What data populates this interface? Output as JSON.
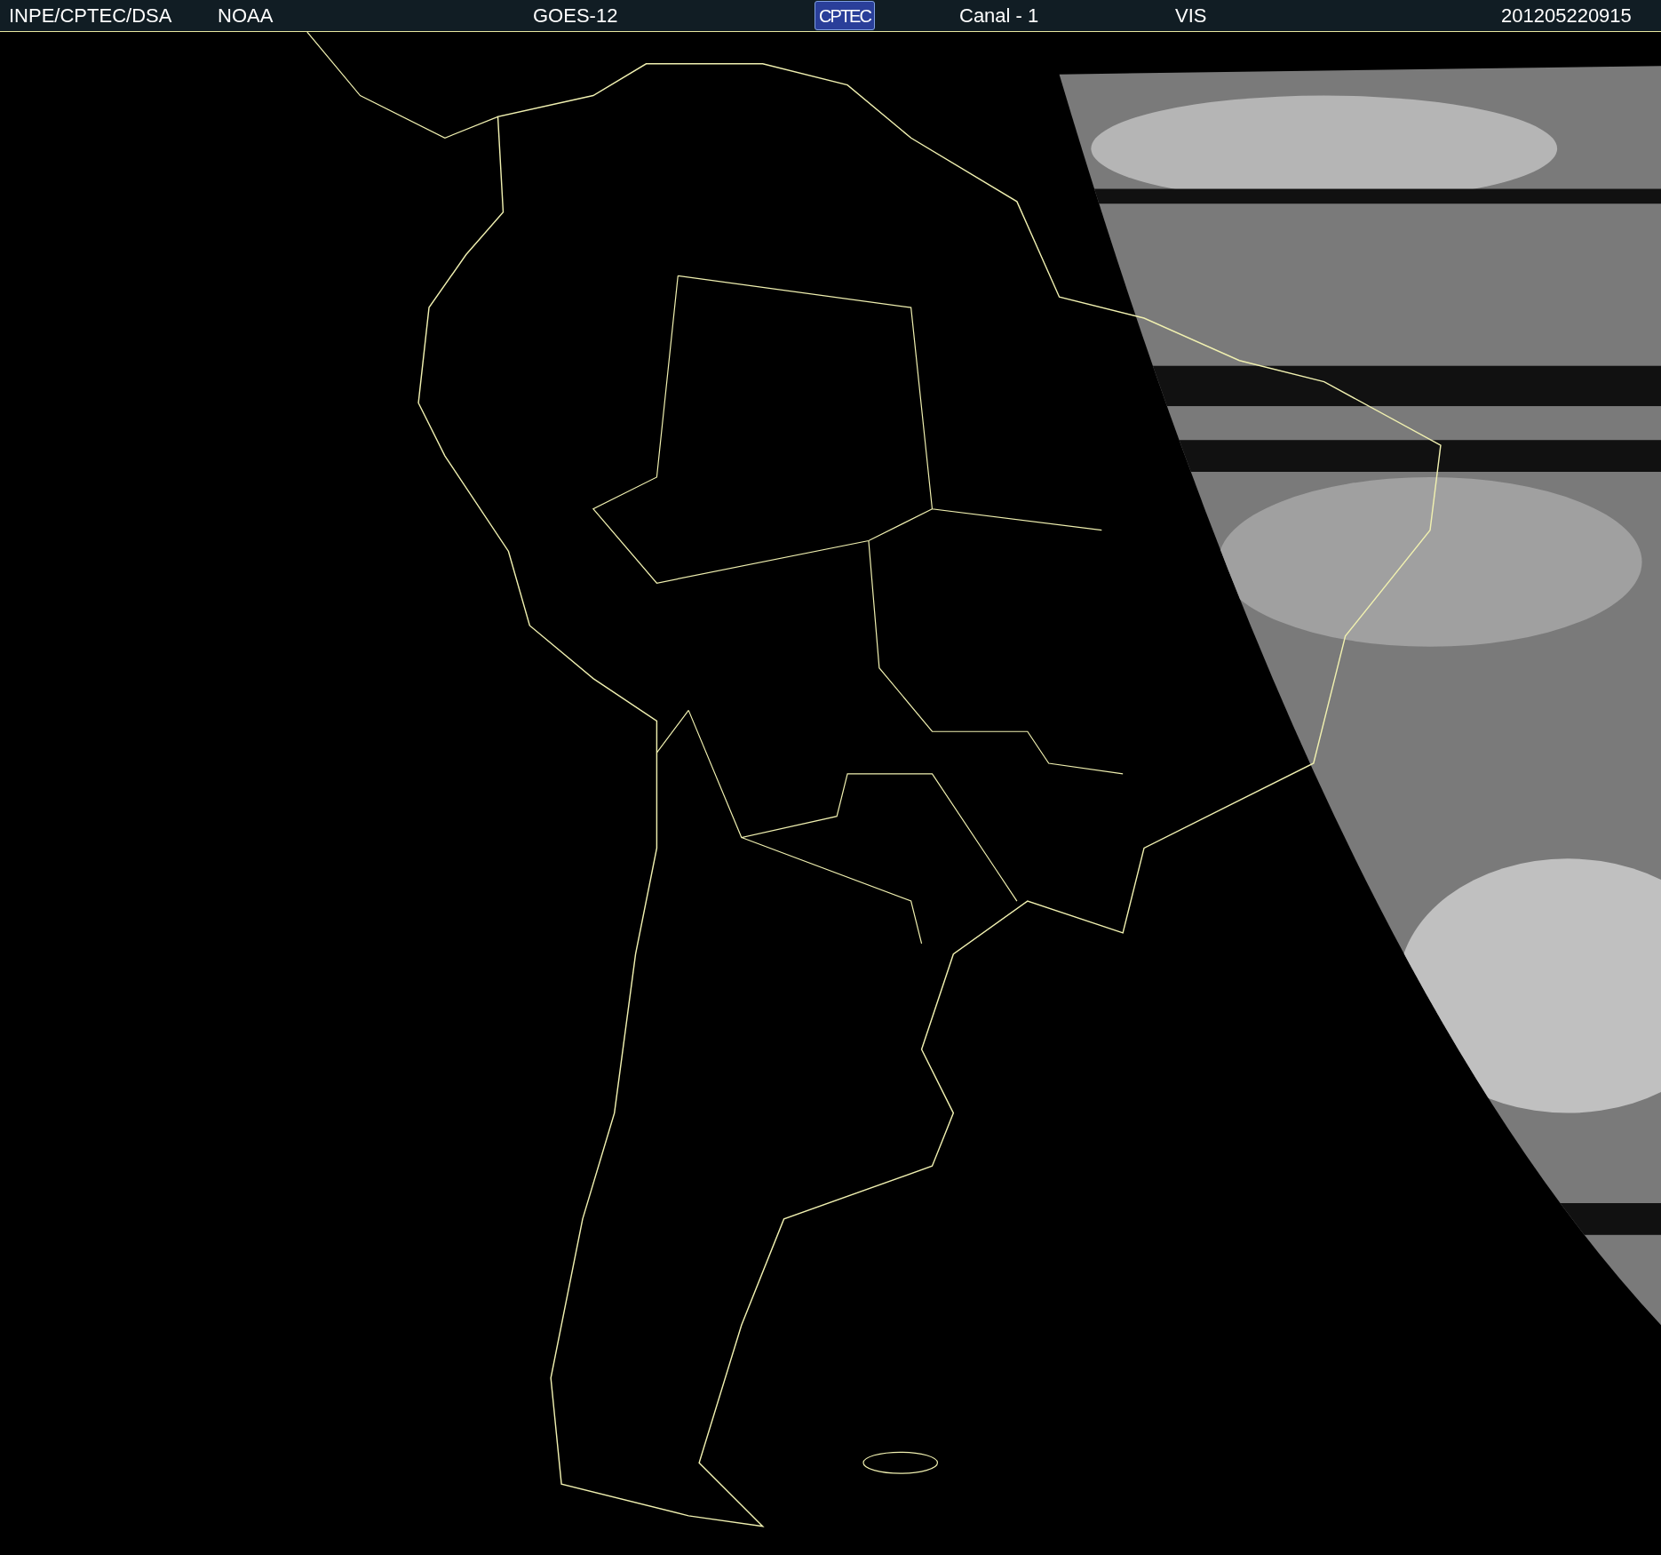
{
  "header": {
    "items": [
      {
        "kind": "text",
        "text": "INPE/CPTEC/DSA"
      },
      {
        "kind": "text",
        "text": "NOAA"
      },
      {
        "kind": "text",
        "text": "GOES-12"
      },
      {
        "kind": "logo",
        "text": "CPTEC"
      },
      {
        "kind": "text",
        "text": "Canal - 1"
      },
      {
        "kind": "text",
        "text": "VIS"
      },
      {
        "kind": "text",
        "text": "201205220915"
      }
    ]
  }
}
